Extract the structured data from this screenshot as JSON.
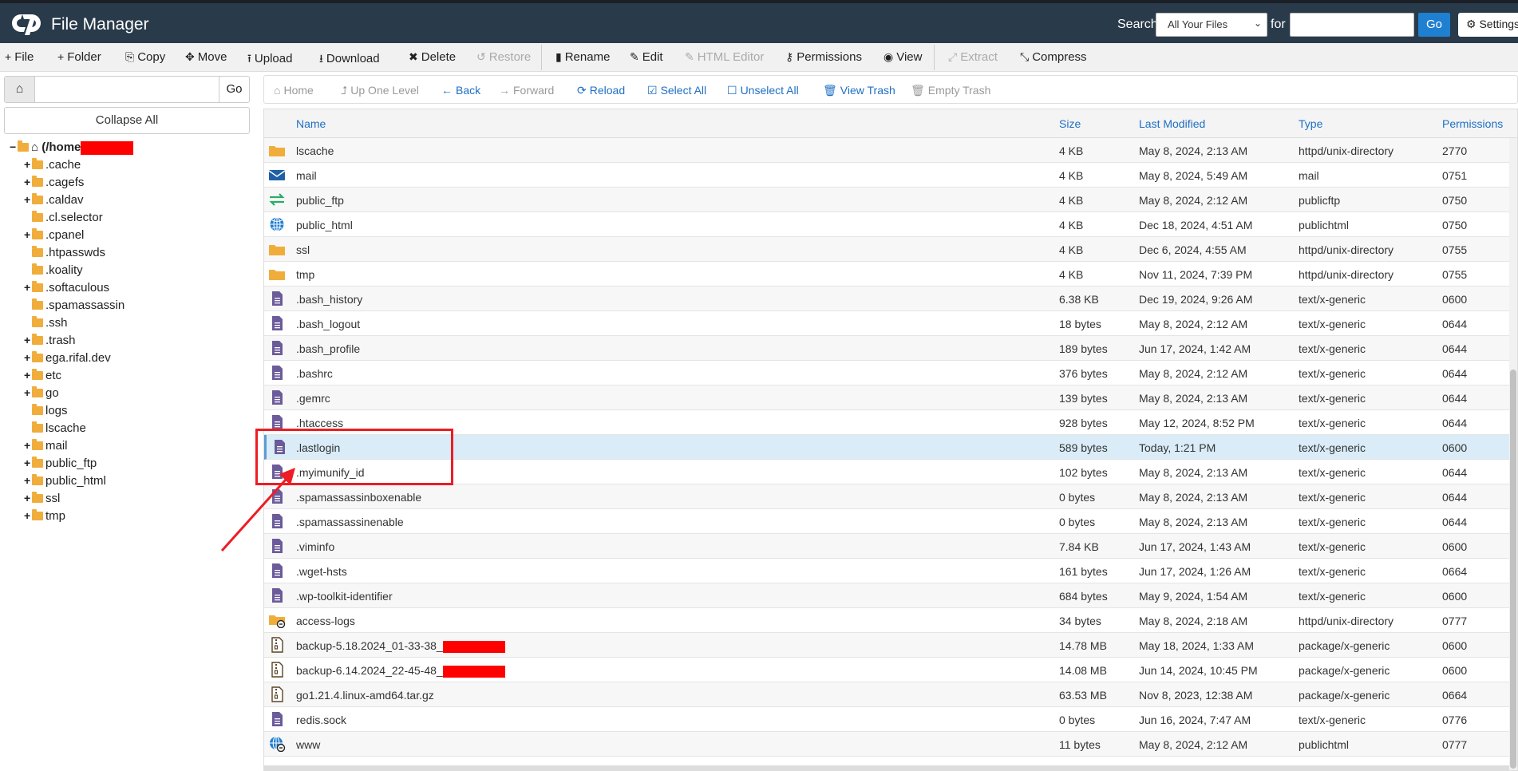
{
  "header": {
    "app_title": "File Manager",
    "search_label": "Search",
    "search_scope": "All Your Files",
    "for_label": "for",
    "search_placeholder": "",
    "go_label": "Go",
    "settings_label": "Settings"
  },
  "toolbar": [
    {
      "label": "File",
      "icon": "plus-icon",
      "glyph": "+"
    },
    {
      "label": "Folder",
      "icon": "plus-icon",
      "glyph": "+"
    },
    {
      "label": "Copy",
      "icon": "copy-icon",
      "glyph": "⎘"
    },
    {
      "label": "Move",
      "icon": "move-icon",
      "glyph": "✥"
    },
    {
      "label": "Upload",
      "icon": "upload-icon",
      "glyph": "⭱"
    },
    {
      "label": "Download",
      "icon": "download-icon",
      "glyph": "⭳"
    },
    {
      "label": "Delete",
      "icon": "delete-icon",
      "glyph": "✖"
    },
    {
      "label": "Restore",
      "icon": "restore-icon",
      "glyph": "↺",
      "disabled": true
    },
    {
      "label": "Rename",
      "icon": "rename-icon",
      "glyph": "▮"
    },
    {
      "label": "Edit",
      "icon": "pencil-icon",
      "glyph": "✎"
    },
    {
      "label": "HTML Editor",
      "icon": "html-editor-icon",
      "glyph": "✎",
      "disabled": true
    },
    {
      "label": "Permissions",
      "icon": "key-icon",
      "glyph": "⚷"
    },
    {
      "label": "View",
      "icon": "eye-icon",
      "glyph": "◉"
    },
    {
      "label": "Extract",
      "icon": "extract-icon",
      "glyph": "⤢",
      "disabled": true
    },
    {
      "label": "Compress",
      "icon": "compress-icon",
      "glyph": "⤡"
    }
  ],
  "left": {
    "path_value": "",
    "go_label": "Go",
    "collapse_label": "Collapse All",
    "root_label": "(/home",
    "tree": [
      {
        "label": ".cache",
        "toggle": "+"
      },
      {
        "label": ".cagefs",
        "toggle": "+"
      },
      {
        "label": ".caldav",
        "toggle": "+"
      },
      {
        "label": ".cl.selector",
        "toggle": ""
      },
      {
        "label": ".cpanel",
        "toggle": "+"
      },
      {
        "label": ".htpasswds",
        "toggle": ""
      },
      {
        "label": ".koality",
        "toggle": ""
      },
      {
        "label": ".softaculous",
        "toggle": "+"
      },
      {
        "label": ".spamassassin",
        "toggle": ""
      },
      {
        "label": ".ssh",
        "toggle": ""
      },
      {
        "label": ".trash",
        "toggle": "+"
      },
      {
        "label": "ega.rifal.dev",
        "toggle": "+"
      },
      {
        "label": "etc",
        "toggle": "+"
      },
      {
        "label": "go",
        "toggle": "+"
      },
      {
        "label": "logs",
        "toggle": ""
      },
      {
        "label": "lscache",
        "toggle": ""
      },
      {
        "label": "mail",
        "toggle": "+"
      },
      {
        "label": "public_ftp",
        "toggle": "+"
      },
      {
        "label": "public_html",
        "toggle": "+"
      },
      {
        "label": "ssl",
        "toggle": "+"
      },
      {
        "label": "tmp",
        "toggle": "+"
      }
    ]
  },
  "actions": [
    {
      "label": "Home",
      "glyph": "⌂",
      "icon": "home-icon",
      "disabled": true
    },
    {
      "label": "Up One Level",
      "glyph": "⮥",
      "icon": "up-level-icon",
      "disabled": true
    },
    {
      "label": "Back",
      "glyph": "←",
      "icon": "arrow-left-icon"
    },
    {
      "label": "Forward",
      "glyph": "→",
      "icon": "arrow-right-icon",
      "disabled": true
    },
    {
      "label": "Reload",
      "glyph": "⟳",
      "icon": "reload-icon"
    },
    {
      "label": "Select All",
      "glyph": "☑",
      "icon": "checkbox-checked-icon"
    },
    {
      "label": "Unselect All",
      "glyph": "☐",
      "icon": "checkbox-empty-icon"
    },
    {
      "label": "View Trash",
      "glyph": "🗑",
      "icon": "trash-icon"
    },
    {
      "label": "Empty Trash",
      "glyph": "🗑",
      "icon": "trash-icon",
      "disabled": true
    }
  ],
  "table": {
    "columns": [
      "Name",
      "Size",
      "Last Modified",
      "Type",
      "Permissions"
    ],
    "rows": [
      {
        "name": "lscache",
        "size": "4 KB",
        "modified": "May 8, 2024, 2:13 AM",
        "type": "httpd/unix-directory",
        "perms": "2770",
        "icon": "folder"
      },
      {
        "name": "mail",
        "size": "4 KB",
        "modified": "May 8, 2024, 5:49 AM",
        "type": "mail",
        "perms": "0751",
        "icon": "mail"
      },
      {
        "name": "public_ftp",
        "size": "4 KB",
        "modified": "May 8, 2024, 2:12 AM",
        "type": "publicftp",
        "perms": "0750",
        "icon": "ftp"
      },
      {
        "name": "public_html",
        "size": "4 KB",
        "modified": "Dec 18, 2024, 4:51 AM",
        "type": "publichtml",
        "perms": "0750",
        "icon": "globe"
      },
      {
        "name": "ssl",
        "size": "4 KB",
        "modified": "Dec 6, 2024, 4:55 AM",
        "type": "httpd/unix-directory",
        "perms": "0755",
        "icon": "folder"
      },
      {
        "name": "tmp",
        "size": "4 KB",
        "modified": "Nov 11, 2024, 7:39 PM",
        "type": "httpd/unix-directory",
        "perms": "0755",
        "icon": "folder"
      },
      {
        "name": ".bash_history",
        "size": "6.38 KB",
        "modified": "Dec 19, 2024, 9:26 AM",
        "type": "text/x-generic",
        "perms": "0600",
        "icon": "file"
      },
      {
        "name": ".bash_logout",
        "size": "18 bytes",
        "modified": "May 8, 2024, 2:12 AM",
        "type": "text/x-generic",
        "perms": "0644",
        "icon": "file"
      },
      {
        "name": ".bash_profile",
        "size": "189 bytes",
        "modified": "Jun 17, 2024, 1:42 AM",
        "type": "text/x-generic",
        "perms": "0644",
        "icon": "file"
      },
      {
        "name": ".bashrc",
        "size": "376 bytes",
        "modified": "May 8, 2024, 2:12 AM",
        "type": "text/x-generic",
        "perms": "0644",
        "icon": "file"
      },
      {
        "name": ".gemrc",
        "size": "139 bytes",
        "modified": "May 8, 2024, 2:13 AM",
        "type": "text/x-generic",
        "perms": "0644",
        "icon": "file"
      },
      {
        "name": ".htaccess",
        "size": "928 bytes",
        "modified": "May 12, 2024, 8:52 PM",
        "type": "text/x-generic",
        "perms": "0644",
        "icon": "file"
      },
      {
        "name": ".lastlogin",
        "size": "589 bytes",
        "modified": "Today, 1:21 PM",
        "type": "text/x-generic",
        "perms": "0600",
        "icon": "file",
        "selected": true
      },
      {
        "name": ".myimunify_id",
        "size": "102 bytes",
        "modified": "May 8, 2024, 2:13 AM",
        "type": "text/x-generic",
        "perms": "0644",
        "icon": "file"
      },
      {
        "name": ".spamassassinboxenable",
        "size": "0 bytes",
        "modified": "May 8, 2024, 2:13 AM",
        "type": "text/x-generic",
        "perms": "0644",
        "icon": "file"
      },
      {
        "name": ".spamassassinenable",
        "size": "0 bytes",
        "modified": "May 8, 2024, 2:13 AM",
        "type": "text/x-generic",
        "perms": "0644",
        "icon": "file"
      },
      {
        "name": ".viminfo",
        "size": "7.84 KB",
        "modified": "Jun 17, 2024, 1:43 AM",
        "type": "text/x-generic",
        "perms": "0600",
        "icon": "file"
      },
      {
        "name": ".wget-hsts",
        "size": "161 bytes",
        "modified": "Jun 17, 2024, 1:26 AM",
        "type": "text/x-generic",
        "perms": "0664",
        "icon": "file"
      },
      {
        "name": ".wp-toolkit-identifier",
        "size": "684 bytes",
        "modified": "May 9, 2024, 1:54 AM",
        "type": "text/x-generic",
        "perms": "0600",
        "icon": "file"
      },
      {
        "name": "access-logs",
        "size": "34 bytes",
        "modified": "May 8, 2024, 2:18 AM",
        "type": "httpd/unix-directory",
        "perms": "0777",
        "icon": "folder-link"
      },
      {
        "name": "backup-5.18.2024_01-33-38_",
        "size": "14.78 MB",
        "modified": "May 18, 2024, 1:33 AM",
        "type": "package/x-generic",
        "perms": "0600",
        "icon": "archive",
        "redacted": true
      },
      {
        "name": "backup-6.14.2024_22-45-48_",
        "size": "14.08 MB",
        "modified": "Jun 14, 2024, 10:45 PM",
        "type": "package/x-generic",
        "perms": "0600",
        "icon": "archive",
        "redacted": true
      },
      {
        "name": "go1.21.4.linux-amd64.tar.gz",
        "size": "63.53 MB",
        "modified": "Nov 8, 2023, 12:38 AM",
        "type": "package/x-generic",
        "perms": "0664",
        "icon": "archive"
      },
      {
        "name": "redis.sock",
        "size": "0 bytes",
        "modified": "Jun 16, 2024, 7:47 AM",
        "type": "text/x-generic",
        "perms": "0776",
        "icon": "file"
      },
      {
        "name": "www",
        "size": "11 bytes",
        "modified": "May 8, 2024, 2:12 AM",
        "type": "publichtml",
        "perms": "0777",
        "icon": "globe-link"
      }
    ]
  },
  "colors": {
    "header_bg": "#293a4a",
    "link_blue": "#1f6fc4",
    "folder": "#f0ad3c",
    "file_icon": "#6b5b9a",
    "annotation_red": "#ee1c24"
  }
}
